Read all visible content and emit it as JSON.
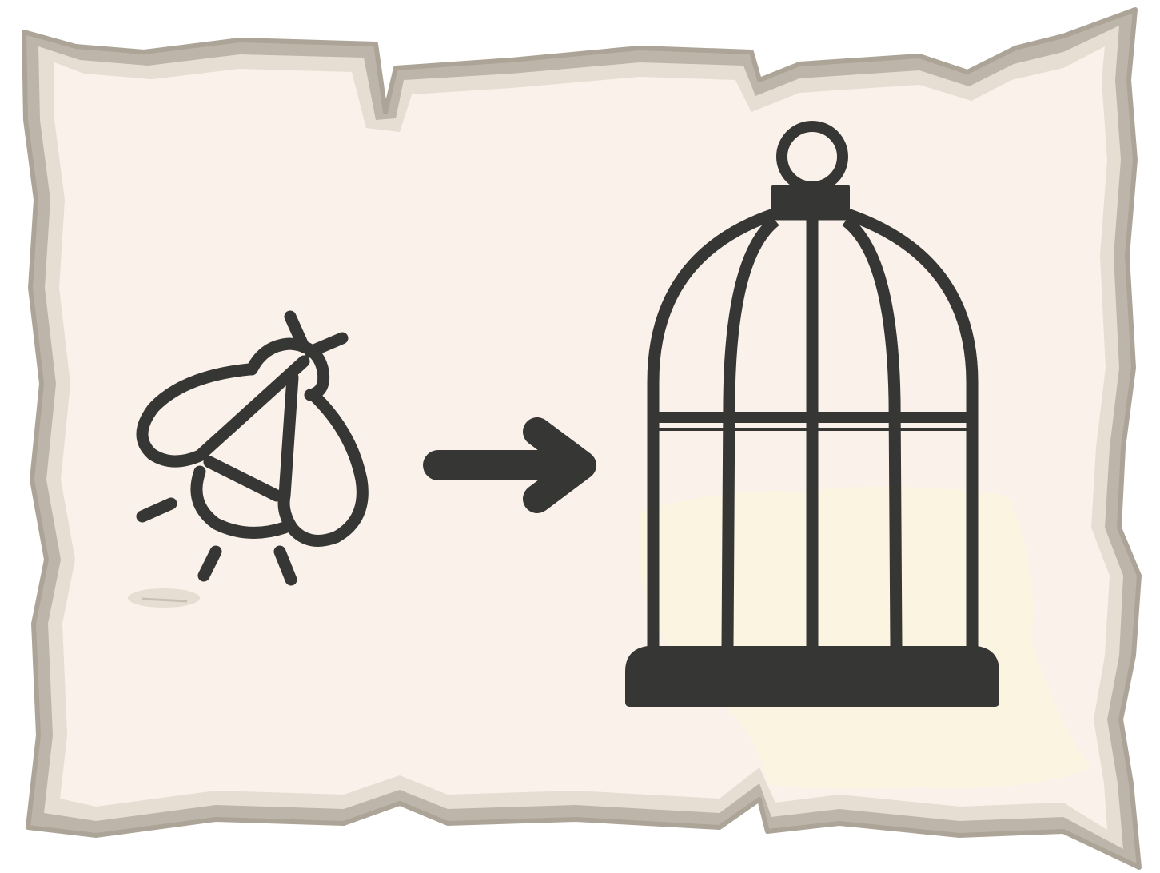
{
  "card": {
    "style": "parchment",
    "colors": {
      "paper": "#f9f1ea",
      "paper_glow": "#fbf4df",
      "border_outer": "#bdb5aa",
      "border_inner": "#e6ded3",
      "ink": "#363634"
    }
  },
  "icons": {
    "source": "firefly-icon",
    "relation": "arrow-right-icon",
    "target": "birdcage-icon"
  }
}
